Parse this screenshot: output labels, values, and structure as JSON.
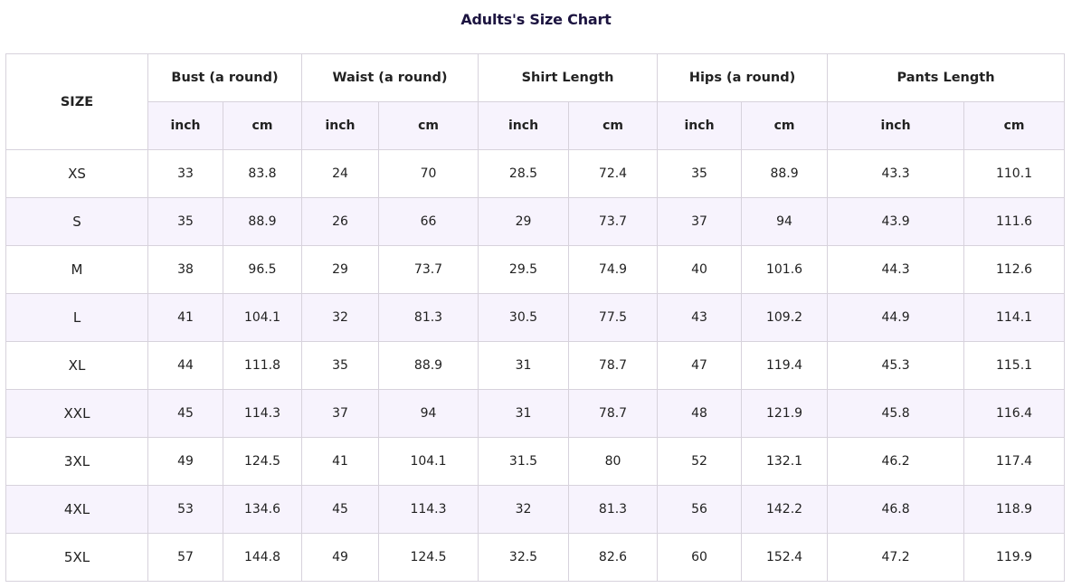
{
  "title": "Adults's Size Chart",
  "header": {
    "size_label": "SIZE",
    "groups": [
      "Bust (a round)",
      "Waist (a round)",
      "Shirt Length",
      "Hips (a round)",
      "Pants Length"
    ],
    "units": [
      "inch",
      "cm",
      "inch",
      "cm",
      "inch",
      "cm",
      "inch",
      "cm",
      "inch",
      "cm"
    ]
  },
  "rows": [
    {
      "size": "XS",
      "values": [
        "33",
        "83.8",
        "24",
        "70",
        "28.5",
        "72.4",
        "35",
        "88.9",
        "43.3",
        "110.1"
      ]
    },
    {
      "size": "S",
      "values": [
        "35",
        "88.9",
        "26",
        "66",
        "29",
        "73.7",
        "37",
        "94",
        "43.9",
        "111.6"
      ]
    },
    {
      "size": "M",
      "values": [
        "38",
        "96.5",
        "29",
        "73.7",
        "29.5",
        "74.9",
        "40",
        "101.6",
        "44.3",
        "112.6"
      ]
    },
    {
      "size": "L",
      "values": [
        "41",
        "104.1",
        "32",
        "81.3",
        "30.5",
        "77.5",
        "43",
        "109.2",
        "44.9",
        "114.1"
      ]
    },
    {
      "size": "XL",
      "values": [
        "44",
        "111.8",
        "35",
        "88.9",
        "31",
        "78.7",
        "47",
        "119.4",
        "45.3",
        "115.1"
      ]
    },
    {
      "size": "XXL",
      "values": [
        "45",
        "114.3",
        "37",
        "94",
        "31",
        "78.7",
        "48",
        "121.9",
        "45.8",
        "116.4"
      ]
    },
    {
      "size": "3XL",
      "values": [
        "49",
        "124.5",
        "41",
        "104.1",
        "31.5",
        "80",
        "52",
        "132.1",
        "46.2",
        "117.4"
      ]
    },
    {
      "size": "4XL",
      "values": [
        "53",
        "134.6",
        "45",
        "114.3",
        "32",
        "81.3",
        "56",
        "142.2",
        "46.8",
        "118.9"
      ]
    },
    {
      "size": "5XL",
      "values": [
        "57",
        "144.8",
        "49",
        "124.5",
        "32.5",
        "82.6",
        "60",
        "152.4",
        "47.2",
        "119.9"
      ]
    }
  ],
  "colors": {
    "title": "#1c1440",
    "stripe": "#f7f3fd",
    "border": "#d7d2dc"
  }
}
